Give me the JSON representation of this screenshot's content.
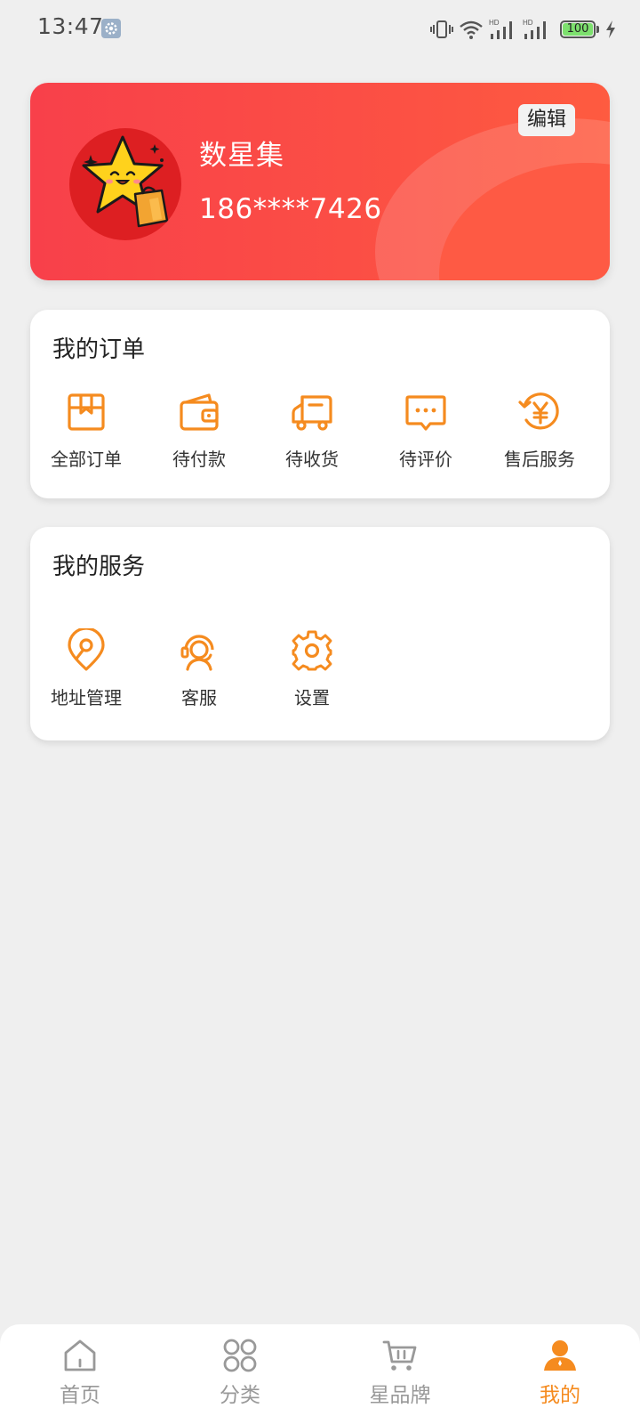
{
  "status_bar": {
    "time": "13:47",
    "battery": "100",
    "battery_fraction": 1.0,
    "icons": [
      "settings-icon",
      "vibrate-icon",
      "wifi-icon",
      "signal-hd-icon",
      "signal-hd-icon",
      "battery-icon",
      "charging-icon"
    ]
  },
  "profile": {
    "name": "数星集",
    "phone": "186****7426",
    "edit_label": "编辑",
    "colors": {
      "card_start": "#f8404a",
      "card_end": "#fe5b40",
      "avatar_bg": "#dd1f22"
    }
  },
  "orders": {
    "title": "我的订单",
    "items": [
      {
        "label": "全部订单",
        "icon": "package-icon"
      },
      {
        "label": "待付款",
        "icon": "wallet-icon"
      },
      {
        "label": "待收货",
        "icon": "truck-icon"
      },
      {
        "label": "待评价",
        "icon": "comment-icon"
      },
      {
        "label": "售后服务",
        "icon": "refund-yen-icon"
      }
    ]
  },
  "services": {
    "title": "我的服务",
    "items": [
      {
        "label": "地址管理",
        "icon": "location-pin-icon"
      },
      {
        "label": "客服",
        "icon": "customer-service-icon"
      },
      {
        "label": "设置",
        "icon": "gear-icon"
      }
    ]
  },
  "bottom_nav": {
    "items": [
      {
        "label": "首页",
        "icon": "home-icon",
        "active": false
      },
      {
        "label": "分类",
        "icon": "category-icon",
        "active": false
      },
      {
        "label": "星品牌",
        "icon": "cart-icon",
        "active": false
      },
      {
        "label": "我的",
        "icon": "user-icon",
        "active": true
      }
    ]
  },
  "theme": {
    "accent": "#f58b1f",
    "inactive": "#999999",
    "background": "#efefef"
  }
}
